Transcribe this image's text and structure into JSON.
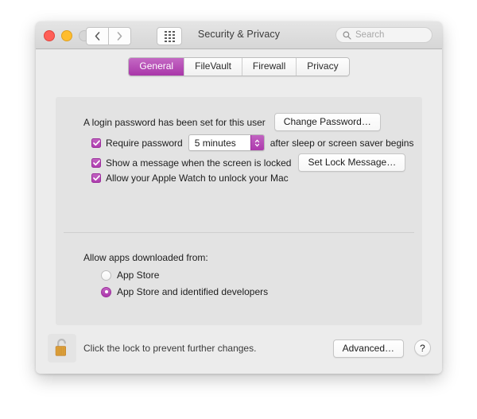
{
  "window": {
    "title": "Security & Privacy",
    "traffic_lights": [
      "close",
      "minimize",
      "zoom"
    ],
    "nav": {
      "back": "back-chevron",
      "forward": "forward-chevron"
    },
    "show_all_icon": "grid-icon",
    "search": {
      "placeholder": "Search",
      "value": "",
      "icon": "search-icon"
    }
  },
  "tabs": [
    {
      "label": "General",
      "active": true
    },
    {
      "label": "FileVault",
      "active": false
    },
    {
      "label": "Firewall",
      "active": false
    },
    {
      "label": "Privacy",
      "active": false
    }
  ],
  "general": {
    "password_status": "A login password has been set for this user",
    "change_password_button": "Change Password…",
    "require_password": {
      "checked": true,
      "label_before": "Require password",
      "interval_value": "5 minutes",
      "label_after": "after sleep or screen saver begins"
    },
    "lock_message": {
      "checked": true,
      "label": "Show a message when the screen is locked",
      "button": "Set Lock Message…"
    },
    "apple_watch": {
      "checked": true,
      "label": "Allow your Apple Watch to unlock your Mac"
    },
    "allow_apps": {
      "heading": "Allow apps downloaded from:",
      "options": [
        {
          "label": "App Store",
          "selected": false
        },
        {
          "label": "App Store and identified developers",
          "selected": true
        }
      ]
    }
  },
  "bottom_bar": {
    "lock_icon": "unlocked-padlock-icon",
    "lock_message": "Click the lock to prevent further changes.",
    "advanced_button": "Advanced…",
    "help_button": "?"
  },
  "colors": {
    "accent": "#b03eb0",
    "window_bg": "#ececec",
    "panel_bg": "#e3e3e3",
    "lock_gold": "#e0a23c"
  }
}
